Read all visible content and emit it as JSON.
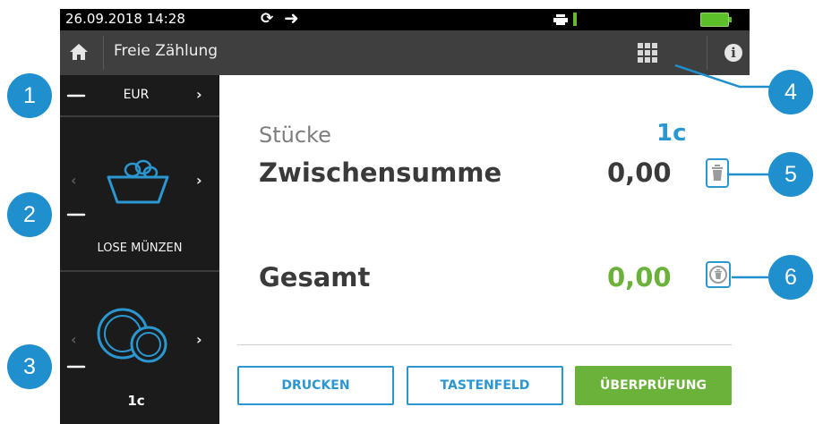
{
  "status_bar": {
    "datetime": "26.09.2018  14:28",
    "sync_glyph": "⟳",
    "forward_glyph": "➜",
    "icons": [
      "sync-icon",
      "forward-icon",
      "printer-icon",
      "signal-icon",
      "battery-icon"
    ]
  },
  "header": {
    "title": "Freie Zählung",
    "icons": [
      "home-icon",
      "keypad-grid-icon",
      "info-icon"
    ],
    "info_glyph": "i"
  },
  "sidebar": {
    "currency": "EUR",
    "chevron": "›",
    "chevron_left": "‹",
    "loose_coins_label": "LOSE MÜNZEN",
    "coin_label": "1c"
  },
  "summary": {
    "pieces_label": "Stücke",
    "pieces_value": "1c",
    "subtotal_label": "Zwischensumme",
    "subtotal_value": "0,00",
    "total_label": "Gesamt",
    "total_value": "0,00"
  },
  "buttons": {
    "print": "DRUCKEN",
    "keypad": "TASTENFELD",
    "verify": "ÜBERPRÜFUNG"
  },
  "callouts": [
    "1",
    "2",
    "3",
    "4",
    "5",
    "6"
  ],
  "colors": {
    "accent_blue": "#2b97d1",
    "accent_green": "#6ab23a",
    "callout_blue": "#1f8fce",
    "dark_panel": "#1b1b1b",
    "header_gray": "#3f3f3f"
  }
}
